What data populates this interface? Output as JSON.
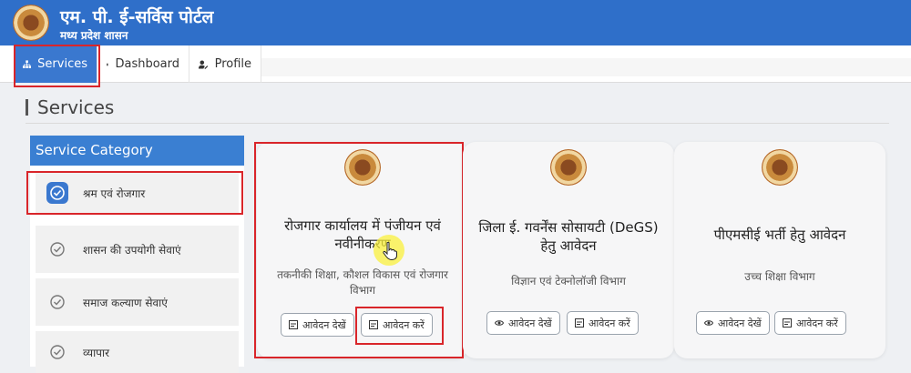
{
  "header": {
    "title": "एम. पी. ई-सर्विस पोर्टल",
    "subtitle": "मध्य प्रदेश शासन",
    "emblem": "mp-govt-emblem"
  },
  "nav": {
    "items": [
      {
        "label": "Services",
        "icon": "sitemap-icon",
        "active": true
      },
      {
        "label": "Dashboard",
        "icon": "dashboard-grid-icon",
        "active": false
      },
      {
        "label": "Profile",
        "icon": "user-edit-icon",
        "active": false
      }
    ]
  },
  "page": {
    "title": "Services"
  },
  "sidebar": {
    "heading": "Service Category",
    "items": [
      {
        "label": "श्रम एवं रोजगार",
        "active": true
      },
      {
        "label": "शासन की उपयोगी सेवाएं",
        "active": false
      },
      {
        "label": "समाज कल्याण सेवाएं",
        "active": false
      },
      {
        "label": "व्यापार",
        "active": false
      }
    ]
  },
  "cards": [
    {
      "name": "रोजगार कार्यालय में पंजीयन एवं नवीनीकरण",
      "dept": "तकनीकी शिक्षा, कौशल विकास एवं रोजगार विभाग",
      "view_label": "आवेदन देखें",
      "apply_label": "आवेदन करें"
    },
    {
      "name": "जिला ई. गवर्नेंस सोसायटी (DeGS) हेतु आवेदन",
      "dept": "विज्ञान एवं टेक्नोलॉजी विभाग",
      "view_label": "आवेदन देखें",
      "apply_label": "आवेदन करें"
    },
    {
      "name": "पीएमसीई भर्ती हेतु आवेदन",
      "dept": "उच्च शिक्षा विभाग",
      "view_label": "आवेदन देखें",
      "apply_label": "आवेदन करें"
    }
  ],
  "colors": {
    "header": "#2f6fc9",
    "active_nav": "#3a78cf",
    "highlight": "#d9252a"
  }
}
